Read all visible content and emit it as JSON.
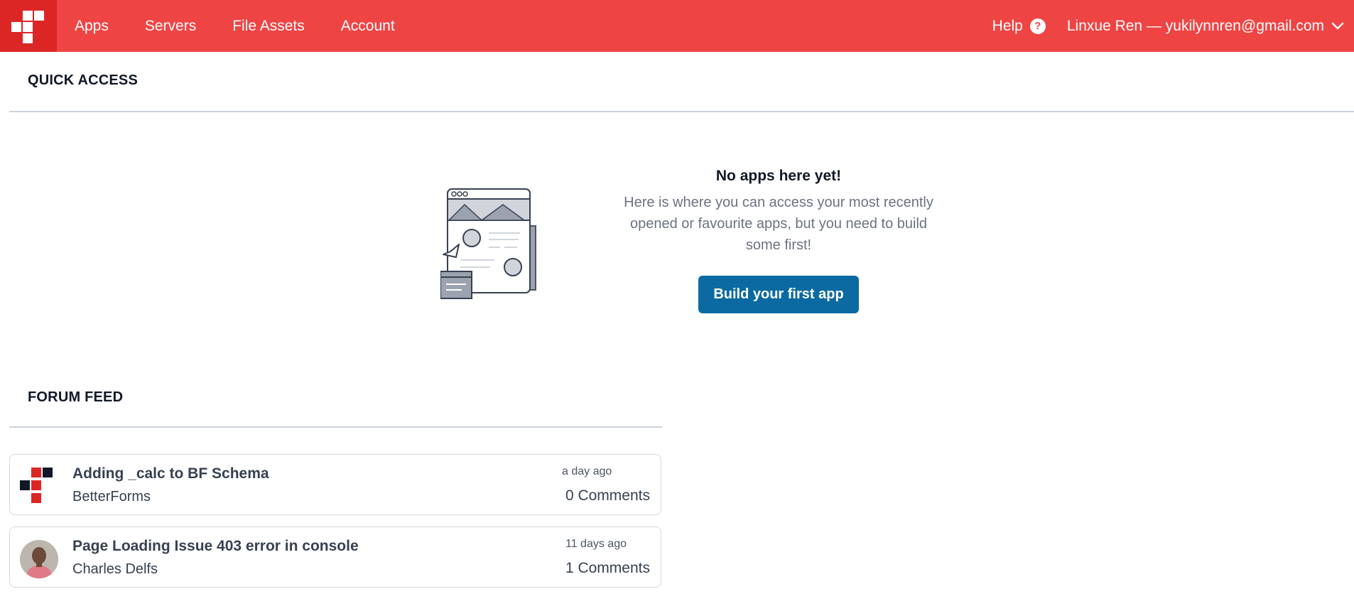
{
  "nav": {
    "items": [
      {
        "label": "Apps"
      },
      {
        "label": "Servers"
      },
      {
        "label": "File Assets"
      },
      {
        "label": "Account"
      }
    ],
    "help_label": "Help",
    "user_label": "Linxue Ren — yukilynnren@gmail.com"
  },
  "quick_access": {
    "title": "QUICK ACCESS",
    "empty_title": "No apps here yet!",
    "empty_line1": "Here is where you can access your most recently",
    "empty_line2": "opened or favourite apps, but you need to build",
    "empty_line3": "some first!",
    "button_label": "Build your first app"
  },
  "forum": {
    "title": "FORUM FEED",
    "posts": [
      {
        "title": "Adding _calc to BF Schema",
        "author": "BetterForms",
        "time": "a day ago",
        "comments": "0 Comments"
      },
      {
        "title": "Page Loading Issue 403 error in console",
        "author": "Charles Delfs",
        "time": "11 days ago",
        "comments": "1 Comments"
      }
    ]
  },
  "colors": {
    "brand_red": "#ef4444",
    "brand_red_dark": "#dc2626",
    "primary_button": "#0b6aa2"
  },
  "icons": [
    "betterforms-logo-icon",
    "help-circle-icon",
    "chevron-down-icon",
    "empty-apps-illustration",
    "user-photo-avatar"
  ]
}
